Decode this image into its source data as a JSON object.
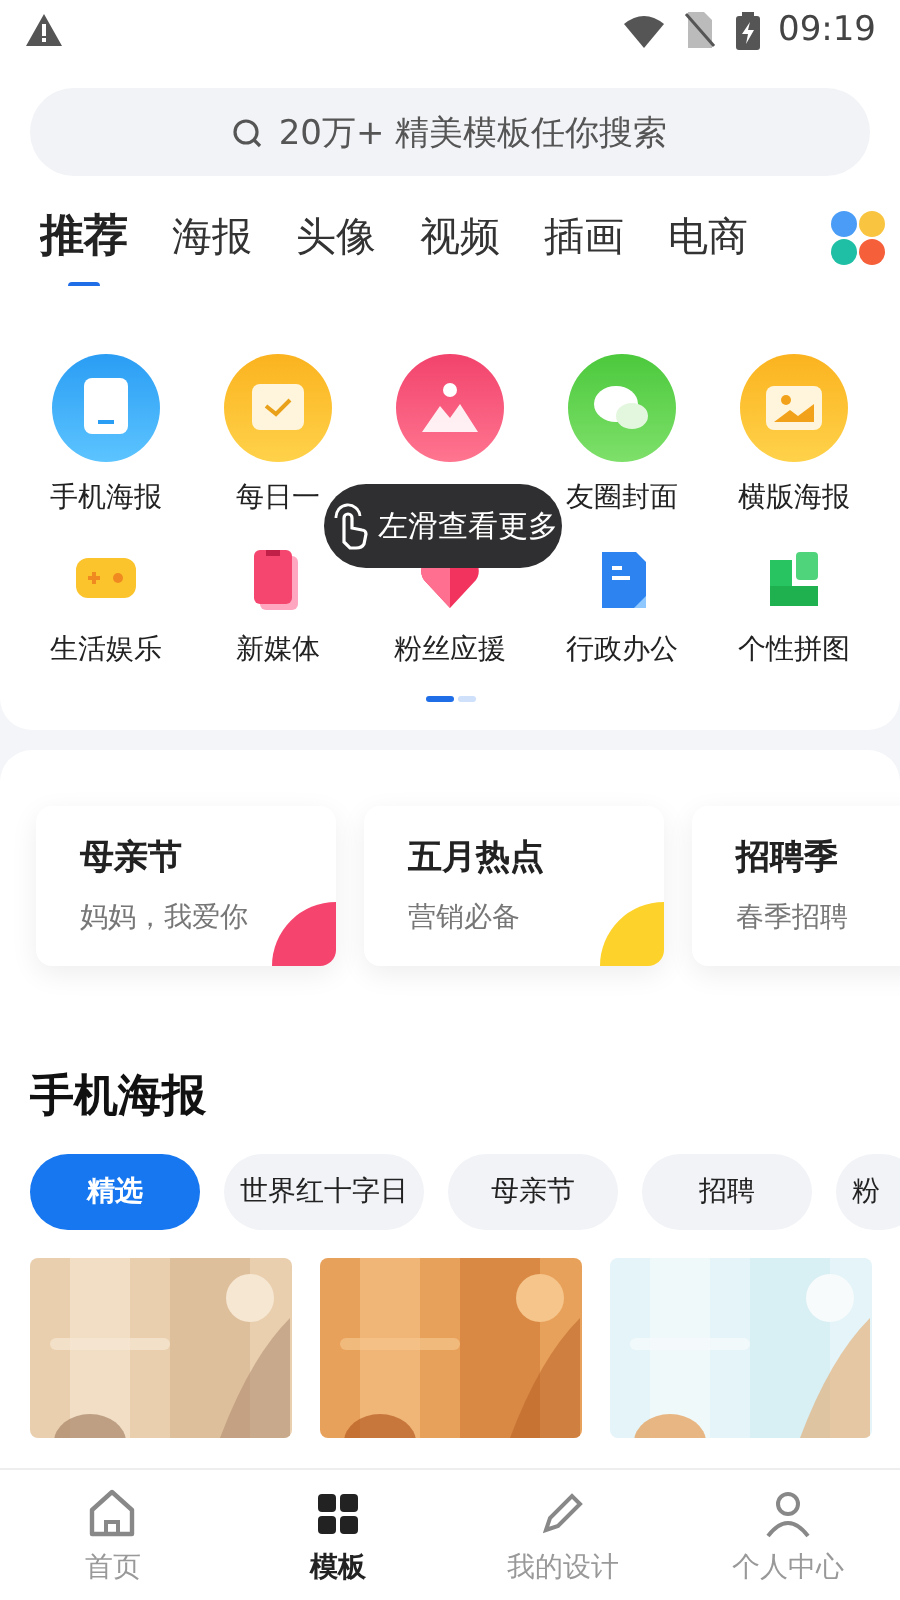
{
  "status_bar": {
    "time": "09:19"
  },
  "search": {
    "placeholder": "20万+ 精美模板任你搜索"
  },
  "tabs": [
    {
      "label": "推荐",
      "selected": true
    },
    {
      "label": "海报",
      "selected": false
    },
    {
      "label": "头像",
      "selected": false
    },
    {
      "label": "视频",
      "selected": false
    },
    {
      "label": "插画",
      "selected": false
    },
    {
      "label": "电商",
      "selected": false
    }
  ],
  "categories": [
    {
      "label": "手机海报",
      "kind": "circle"
    },
    {
      "label": "每日一",
      "kind": "circle"
    },
    {
      "kind": "circle"
    },
    {
      "label": "友圈封面",
      "kind": "circle"
    },
    {
      "label": "横版海报",
      "kind": "circle"
    },
    {
      "label": "生活娱乐",
      "kind": "flat"
    },
    {
      "label": "新媒体",
      "kind": "flat"
    },
    {
      "label": "粉丝应援",
      "kind": "flat"
    },
    {
      "label": "行政办公",
      "kind": "flat"
    },
    {
      "label": "个性拼图",
      "kind": "flat"
    }
  ],
  "toast": {
    "text": "左滑查看更多"
  },
  "pager": [
    {
      "selected": true
    },
    {
      "selected": false
    }
  ],
  "topics": [
    {
      "title": "母亲节",
      "subtitle": "妈妈，我爱你",
      "color": "#f5456e"
    },
    {
      "title": "五月热点",
      "subtitle": "营销必备",
      "color": "#fdd22b"
    },
    {
      "title": "招聘季",
      "subtitle": "春季招聘"
    }
  ],
  "section": {
    "title": "手机海报"
  },
  "chips": [
    {
      "label": "精选",
      "selected": true
    },
    {
      "label": "世界红十字日",
      "selected": false
    },
    {
      "label": "母亲节",
      "selected": false
    },
    {
      "label": "招聘",
      "selected": false
    },
    {
      "label": "粉",
      "selected": false
    }
  ],
  "nav": [
    {
      "label": "首页",
      "selected": false
    },
    {
      "label": "模板",
      "selected": true
    },
    {
      "label": "我的设计",
      "selected": false
    },
    {
      "label": "个人中心",
      "selected": false
    }
  ]
}
